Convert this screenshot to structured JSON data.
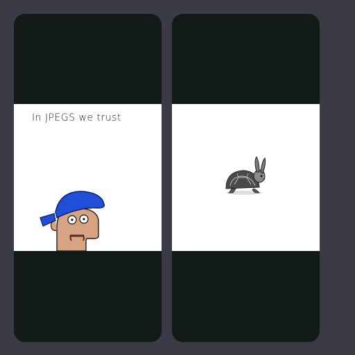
{
  "cards": [
    {
      "id": "meme",
      "caption": "In JPEGS we trust",
      "image_icon": "cartoon-face-blue-bandana"
    },
    {
      "id": "creature",
      "image_icon": "rabbit-turtle-hybrid"
    }
  ],
  "colors": {
    "background": "#3b3b45",
    "card": "#111a16",
    "media": "#ffffff",
    "bandana": "#1f4ed8",
    "skin": "#d6a383"
  }
}
